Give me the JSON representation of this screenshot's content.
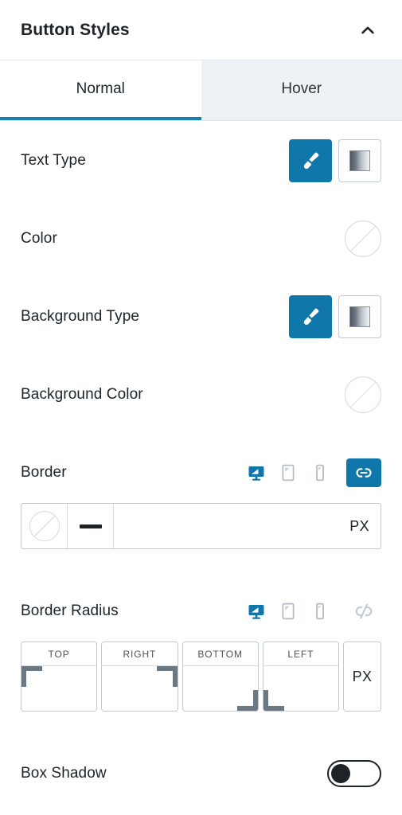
{
  "header": {
    "title": "Button Styles",
    "collapse_icon": "chevron-up-icon"
  },
  "tabs": [
    {
      "label": "Normal",
      "active": true
    },
    {
      "label": "Hover",
      "active": false
    }
  ],
  "colors": {
    "accent": "#1077ab",
    "tab_active_underline": "#1b7fad",
    "tab_inactive_bg": "#eef1f6",
    "text": "#1d2327",
    "border": "#c3c9d1",
    "corner_marker": "#6a7884"
  },
  "sections": {
    "text_type": {
      "label": "Text Type",
      "options": [
        {
          "icon": "brush-icon",
          "active": true
        },
        {
          "icon": "gradient-icon",
          "active": false
        }
      ]
    },
    "color": {
      "label": "Color",
      "swatch_value": "",
      "swatch_state": "empty"
    },
    "background_type": {
      "label": "Background Type",
      "options": [
        {
          "icon": "brush-icon",
          "active": true
        },
        {
          "icon": "gradient-icon",
          "active": false
        }
      ]
    },
    "background_color": {
      "label": "Background Color",
      "swatch_value": "",
      "swatch_state": "empty"
    },
    "border": {
      "label": "Border",
      "devices": [
        {
          "icon": "desktop-icon",
          "active": true
        },
        {
          "icon": "tablet-icon",
          "active": false
        },
        {
          "icon": "mobile-icon",
          "active": false
        }
      ],
      "link_icon": "link-icon",
      "link_active": true,
      "color_swatch_state": "empty",
      "style_glyph": "solid-line-icon",
      "width_value": "",
      "width_placeholder": "",
      "unit": "PX"
    },
    "border_radius": {
      "label": "Border Radius",
      "devices": [
        {
          "icon": "desktop-icon",
          "active": true
        },
        {
          "icon": "tablet-icon",
          "active": false
        },
        {
          "icon": "mobile-icon",
          "active": false
        }
      ],
      "link_icon": "unlink-icon",
      "link_active": false,
      "corners": [
        {
          "caption": "TOP",
          "value": "",
          "corner": "tl"
        },
        {
          "caption": "RIGHT",
          "value": "",
          "corner": "tr"
        },
        {
          "caption": "BOTTOM",
          "value": "",
          "corner": "br"
        },
        {
          "caption": "LEFT",
          "value": "",
          "corner": "bl"
        }
      ],
      "unit": "PX"
    },
    "box_shadow": {
      "label": "Box Shadow",
      "toggle_on": false
    }
  }
}
